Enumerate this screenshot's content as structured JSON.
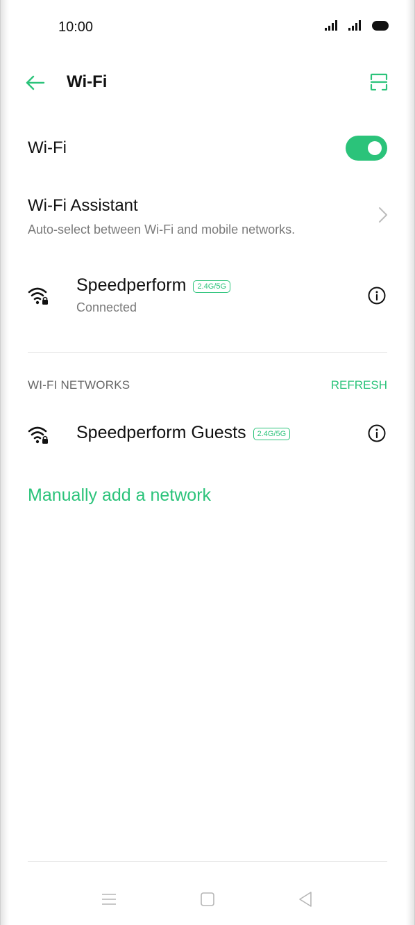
{
  "status_bar": {
    "time": "10:00",
    "icons": [
      "signal-icon",
      "signal-icon",
      "battery-icon"
    ]
  },
  "header": {
    "title": "Wi-Fi",
    "back_icon": "arrow-left-icon",
    "scan_icon": "qr-scan-icon"
  },
  "wifi_toggle": {
    "label": "Wi-Fi",
    "enabled": true
  },
  "wifi_assistant": {
    "title": "Wi-Fi Assistant",
    "subtitle": "Auto-select between Wi-Fi and mobile networks."
  },
  "connected_network": {
    "name": "Speedperform",
    "band": "2.4G/5G",
    "status": "Connected"
  },
  "networks_section": {
    "header": "WI-FI NETWORKS",
    "refresh_label": "REFRESH",
    "items": [
      {
        "name": "Speedperform Guests",
        "band": "2.4G/5G"
      }
    ]
  },
  "manual_add_label": "Manually add a network",
  "nav_bar": {
    "icons": [
      "menu-icon",
      "home-icon",
      "back-icon"
    ]
  },
  "colors": {
    "accent": "#2bc37a",
    "text": "#111111",
    "secondary": "#7a7a7a"
  }
}
